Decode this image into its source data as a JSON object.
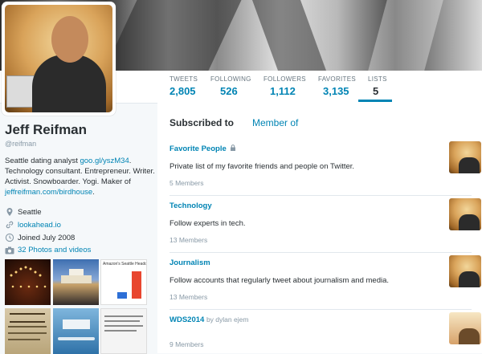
{
  "header": {
    "stats": [
      {
        "label": "TWEETS",
        "value": "2,805"
      },
      {
        "label": "FOLLOWING",
        "value": "526"
      },
      {
        "label": "FOLLOWERS",
        "value": "1,112"
      },
      {
        "label": "FAVORITES",
        "value": "3,135"
      },
      {
        "label": "LISTS",
        "value": "5"
      }
    ]
  },
  "profile": {
    "name": "Jeff Reifman",
    "handle": "@reifman",
    "bio_prefix": "Seattle dating analyst ",
    "bio_link": "goo.gl/yszM34",
    "bio_mid": ". Technology consultant. Entrepreneur. Writer. Activist. Snowboarder. Yogi. Maker of ",
    "bio_link2": "jeffreifman.com/birdhouse",
    "bio_suffix": ".",
    "location": "Seattle",
    "website": "lookahead.io",
    "joined": "Joined July 2008",
    "photos_label": "32 Photos and videos",
    "thumb_text": "Amazon's Seattle Headcount Fore"
  },
  "main": {
    "tabs": [
      "Subscribed to",
      "Member of"
    ],
    "lists": [
      {
        "title": "Favorite People",
        "desc": "Private list of my favorite friends and people on Twitter.",
        "members": "5 Members"
      },
      {
        "title": "Technology",
        "desc": "Follow experts in tech.",
        "members": "13 Members"
      },
      {
        "title": "Journalism",
        "desc": "Follow accounts that regularly tweet about journalism and media.",
        "members": "13 Members"
      },
      {
        "title": "WDS2014",
        "by": "by dylan ejem",
        "members": "9 Members"
      }
    ]
  },
  "colors": {
    "link": "#0084b4",
    "text": "#292f33",
    "muted": "#8899a6"
  }
}
